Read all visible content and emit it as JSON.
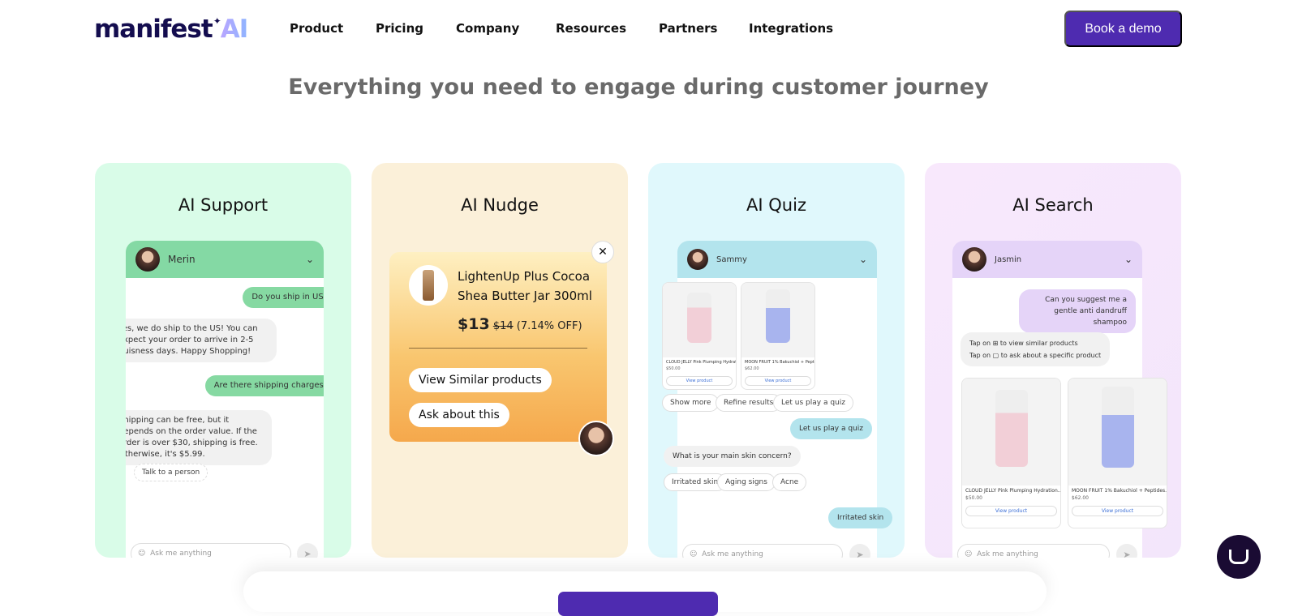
{
  "header": {
    "logo_text": "manifest",
    "logo_ai": "AI",
    "nav": [
      "Product",
      "Pricing",
      "Company",
      "Resources",
      "Partners",
      "Integrations"
    ],
    "cta": "Book a demo"
  },
  "headline": "Everything you need to engage during customer journey",
  "colors": {
    "brand": "#4e2bb0",
    "support_bg": "#d9fce8",
    "nudge_bg": "#fbf0d9",
    "quiz_bg": "#e0f8fc",
    "search_bg": "#f6e6fc"
  },
  "support": {
    "title": "AI Support",
    "agent": "Merin",
    "messages": [
      {
        "from": "user",
        "text": "Do you ship in US?"
      },
      {
        "from": "bot",
        "text": "Yes, we do ship to the US! You can expect your order to arrive in 2-5 buisness days. Happy Shopping!"
      },
      {
        "from": "user",
        "text": "Are there shipping charges?"
      },
      {
        "from": "bot",
        "text": "Shipping can be free, but it depends on the order value. If the order is over $30, shipping is free. Otherwise, it's $5.99."
      }
    ],
    "talk": "Talk to a person",
    "placeholder": "Ask me anything"
  },
  "nudge": {
    "title": "AI Nudge",
    "product": "LightenUp Plus Cocoa Shea Butter Jar 300ml",
    "price": "$13",
    "old_price": "$14",
    "discount": "(7.14% OFF)",
    "btn1": "View Similar products",
    "btn2": "Ask about this"
  },
  "quiz": {
    "title": "AI Quiz",
    "agent": "Sammy",
    "products": [
      {
        "name": "CLOUD JELLY Pink Plumping Hydration...",
        "price": "$50.00",
        "label": "CLOUD JELLY",
        "view": "View product"
      },
      {
        "name": "MOON FRUIT 1% Bakuchiol + Peptides...",
        "price": "$62.00",
        "label": "MOON FRUIT",
        "view": "View product"
      }
    ],
    "chips": [
      "Show more",
      "Refine results",
      "Let us play a quiz"
    ],
    "user1": "Let us play a quiz",
    "question": "What is your main skin concern?",
    "options": [
      "Irritated skin",
      "Aging signs",
      "Acne"
    ],
    "user2": "Irritated skin",
    "placeholder": "Ask me anything"
  },
  "search": {
    "title": "AI Search",
    "agent": "Jasmin",
    "user": "Can you suggest me a gentle anti dandruff shampoo",
    "tip1": "Tap on ⊞ to view similar products",
    "tip2": "Tap on ▢ to ask about a specific product",
    "products": [
      {
        "name": "CLOUD JELLY Pink Plumping Hydration...",
        "price": "$50.00",
        "label": "CLOUD JELLY",
        "view": "View product"
      },
      {
        "name": "MOON FRUIT 1% Bakuchiol + Peptides...",
        "price": "$62.00",
        "label": "MOON FRUIT",
        "view": "View product"
      }
    ],
    "placeholder": "Ask me anything"
  }
}
